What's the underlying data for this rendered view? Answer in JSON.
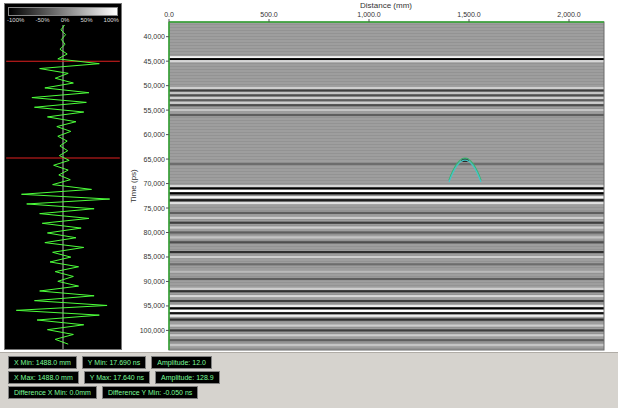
{
  "trace_panel": {
    "colorbar_ticks": [
      "-100%",
      "-50%",
      "0%",
      "50%",
      "100%"
    ],
    "trace": [
      3,
      -4,
      5,
      -3,
      4,
      -6,
      8,
      -10,
      70,
      -45,
      10,
      -15,
      20,
      -35,
      50,
      -60,
      45,
      -55,
      40,
      -30,
      25,
      -12,
      15,
      -10,
      8,
      -6,
      9,
      -7,
      12,
      -18,
      10,
      -8,
      14,
      -20,
      55,
      -80,
      90,
      -70,
      60,
      -45,
      50,
      -40,
      35,
      -30,
      25,
      -35,
      40,
      -20,
      15,
      -25,
      30,
      -15,
      20,
      -10,
      30,
      -45,
      60,
      -55,
      85,
      -90,
      70,
      -50,
      40,
      -30,
      20,
      -15,
      10
    ],
    "trace_start_time": 37000,
    "trace_step": 1000,
    "markers": [
      {
        "time": 44500
      },
      {
        "time": 64500
      }
    ]
  },
  "radargram": {
    "x_axis": {
      "title": "Distance (mm)",
      "ticks": [
        {
          "label": "0.0",
          "value": 0
        },
        {
          "label": "500.0",
          "value": 500
        },
        {
          "label": "1,000.0",
          "value": 1000
        },
        {
          "label": "1,500.0",
          "value": 1500
        },
        {
          "label": "2,000.0",
          "value": 2000
        }
      ]
    },
    "y_axis": {
      "title": "Time (ps)",
      "ticks": [
        {
          "label": "40,000",
          "value": 40000
        },
        {
          "label": "45,000",
          "value": 45000
        },
        {
          "label": "50,000",
          "value": 50000
        },
        {
          "label": "55,000",
          "value": 55000
        },
        {
          "label": "60,000",
          "value": 60000
        },
        {
          "label": "65,000",
          "value": 65000
        },
        {
          "label": "70,000",
          "value": 70000
        },
        {
          "label": "75,000",
          "value": 75000
        },
        {
          "label": "80,000",
          "value": 80000
        },
        {
          "label": "85,000",
          "value": 85000
        },
        {
          "label": "90,000",
          "value": 90000
        },
        {
          "label": "95,000",
          "value": 95000
        },
        {
          "label": "100,000",
          "value": 100000
        }
      ]
    },
    "reflectors": [
      {
        "time": 44200,
        "amp": 0.9
      },
      {
        "time": 44600,
        "amp": -1
      },
      {
        "time": 45000,
        "amp": 0.6
      },
      {
        "time": 50500,
        "amp": 0.5
      },
      {
        "time": 51000,
        "amp": -0.6
      },
      {
        "time": 51500,
        "amp": 0.4
      },
      {
        "time": 52000,
        "amp": -0.5
      },
      {
        "time": 52500,
        "amp": 0.5
      },
      {
        "time": 53000,
        "amp": -0.4
      },
      {
        "time": 53500,
        "amp": 0.5
      },
      {
        "time": 54000,
        "amp": -0.5
      },
      {
        "time": 55000,
        "amp": 0.4
      },
      {
        "time": 56000,
        "amp": -0.4
      },
      {
        "time": 66000,
        "amp": -0.3
      },
      {
        "time": 70500,
        "amp": 0.6
      },
      {
        "time": 71000,
        "amp": -1
      },
      {
        "time": 71500,
        "amp": 1
      },
      {
        "time": 72000,
        "amp": -1
      },
      {
        "time": 72800,
        "amp": 0.9
      },
      {
        "time": 73400,
        "amp": -0.8
      },
      {
        "time": 74000,
        "amp": 0.7
      },
      {
        "time": 76000,
        "amp": -0.4
      },
      {
        "time": 77000,
        "amp": 0.5
      },
      {
        "time": 78000,
        "amp": -0.6
      },
      {
        "time": 79000,
        "amp": 0.5
      },
      {
        "time": 80000,
        "amp": -0.4
      },
      {
        "time": 81000,
        "amp": 0.4
      },
      {
        "time": 82000,
        "amp": -0.5
      },
      {
        "time": 84000,
        "amp": -0.7
      },
      {
        "time": 85000,
        "amp": 0.5
      },
      {
        "time": 86500,
        "amp": -0.3
      },
      {
        "time": 88000,
        "amp": 0.3
      },
      {
        "time": 89500,
        "amp": -0.4
      },
      {
        "time": 91500,
        "amp": 0.5
      },
      {
        "time": 92000,
        "amp": -0.7
      },
      {
        "time": 93000,
        "amp": 0.6
      },
      {
        "time": 94000,
        "amp": -0.6
      },
      {
        "time": 95000,
        "amp": 0.8
      },
      {
        "time": 95500,
        "amp": -1
      },
      {
        "time": 96000,
        "amp": 1
      },
      {
        "time": 96500,
        "amp": -0.9
      },
      {
        "time": 97000,
        "amp": 0.8
      },
      {
        "time": 97800,
        "amp": -0.7
      },
      {
        "time": 99000,
        "amp": 0.5
      },
      {
        "time": 100000,
        "amp": -0.6
      },
      {
        "time": 101000,
        "amp": 0.5
      },
      {
        "time": 102000,
        "amp": -0.4
      },
      {
        "time": 103000,
        "amp": 0.4
      }
    ],
    "hyperbola": {
      "apex_distance": 1480,
      "apex_time": 64800,
      "half_width_mm": 80,
      "drop_ps": 4500
    }
  },
  "status_bar": {
    "rows": [
      [
        {
          "text": "X Min: 1488.0 mm"
        },
        {
          "text": "Y Min: 17.690 ns"
        },
        {
          "text": "Amplitude: 12.0"
        }
      ],
      [
        {
          "text": "X Max: 1488.0 mm"
        },
        {
          "text": "Y Max: 17.640 ns"
        },
        {
          "text": "Amplitude: 128.9"
        }
      ],
      [
        {
          "text": "Difference X Min: 0.0mm"
        },
        {
          "text": "Difference Y Min: -0.050 ns"
        }
      ]
    ]
  }
}
